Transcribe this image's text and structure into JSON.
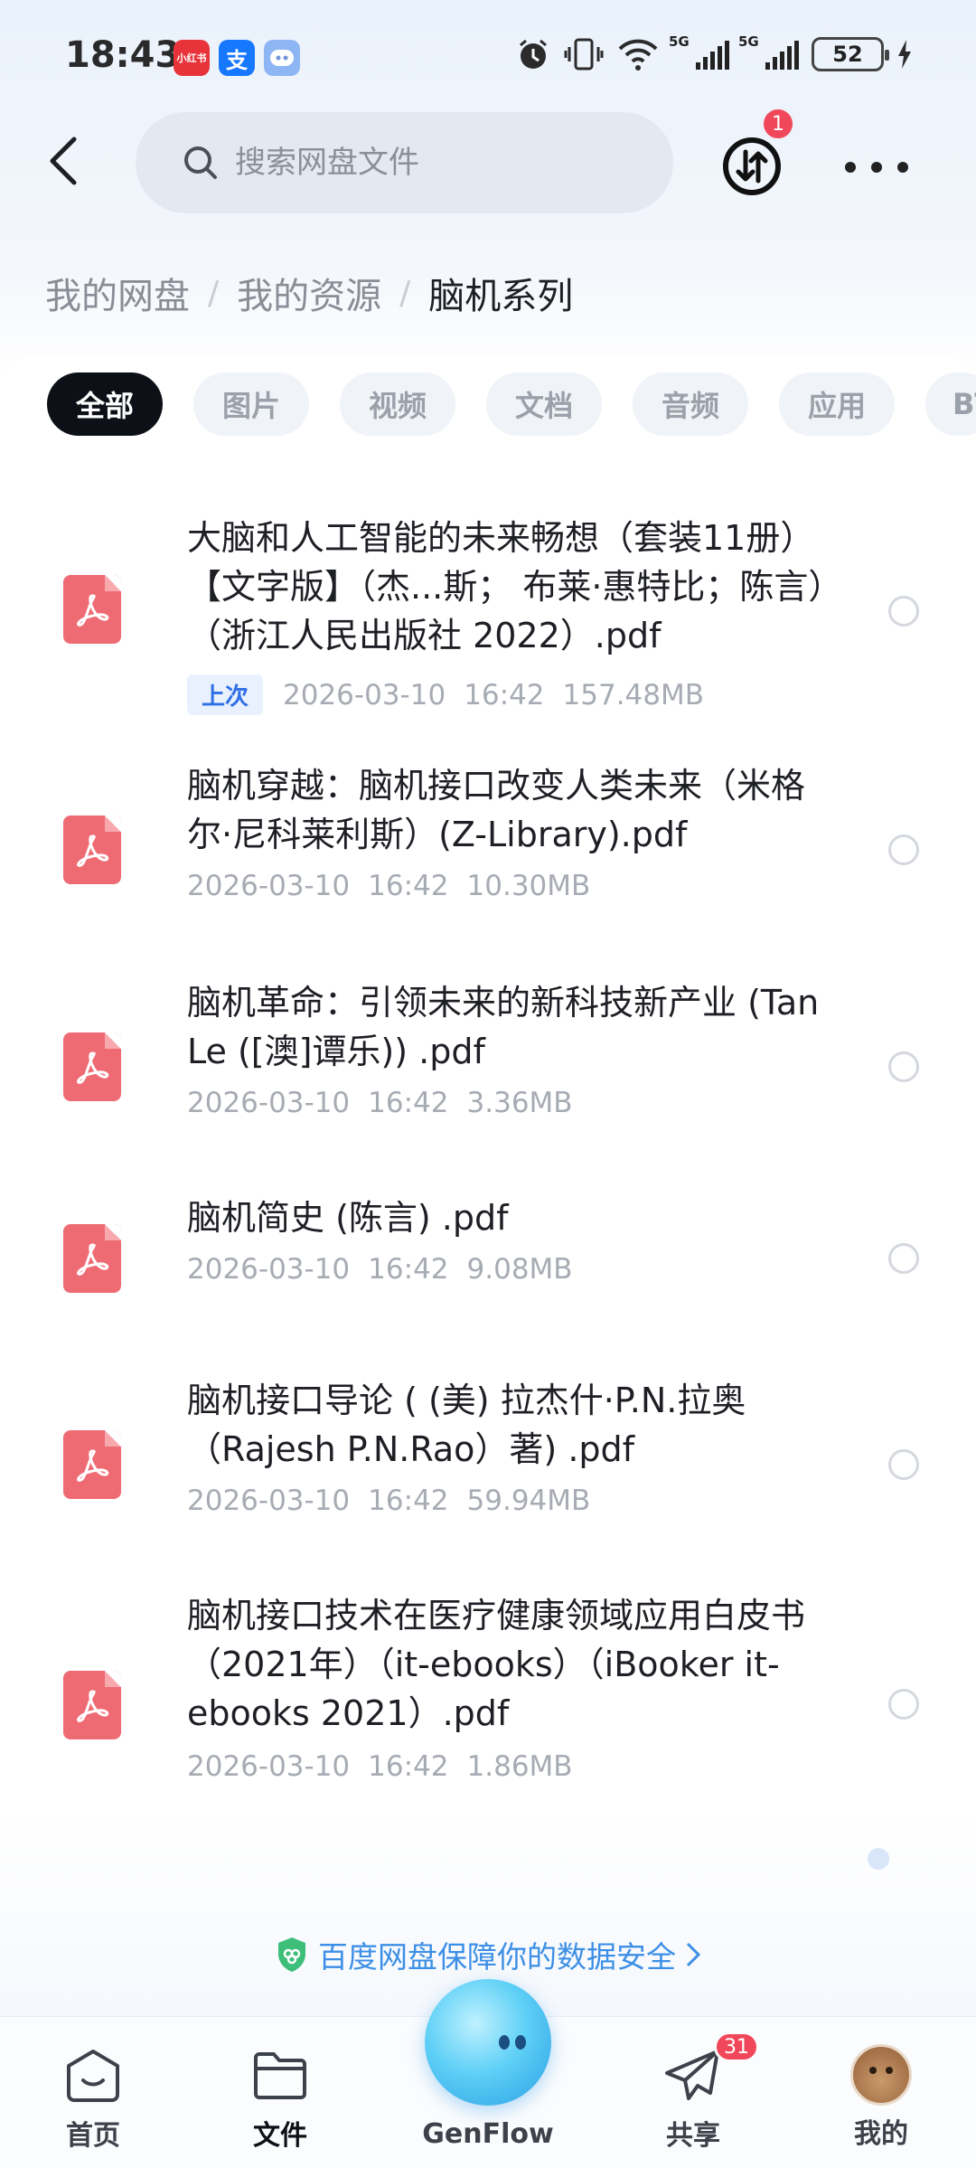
{
  "status_bar": {
    "time": "18:43",
    "app_badges": [
      "小红书",
      "支",
      "bot"
    ],
    "network_labels": [
      "5G",
      "5G"
    ],
    "battery": "52"
  },
  "header": {
    "search_placeholder": "搜索网盘文件",
    "transfer_badge": "1"
  },
  "breadcrumb": [
    "我的网盘",
    "我的资源",
    "脑机系列"
  ],
  "filter_tabs": [
    {
      "label": "全部",
      "active": true
    },
    {
      "label": "图片"
    },
    {
      "label": "视频"
    },
    {
      "label": "文档"
    },
    {
      "label": "音频"
    },
    {
      "label": "应用"
    },
    {
      "label": "BT"
    }
  ],
  "files": [
    {
      "name": "大脑和人工智能的未来畅想（套装11册）【文字版】（杰...斯； 布莱·惠特比；陈言）（浙江人民出版社 2022）.pdf",
      "tag": "上次",
      "date": "2026-03-10",
      "time": "16:42",
      "size": "157.48MB"
    },
    {
      "name": "脑机穿越：脑机接口改变人类未来（米格尔·尼科莱利斯）(Z-Library).pdf",
      "date": "2026-03-10",
      "time": "16:42",
      "size": "10.30MB"
    },
    {
      "name": "脑机革命：引领未来的新科技新产业 (Tan Le ([澳]谭乐)) .pdf",
      "date": "2026-03-10",
      "time": "16:42",
      "size": "3.36MB"
    },
    {
      "name": "脑机简史 (陈言) .pdf",
      "date": "2026-03-10",
      "time": "16:42",
      "size": "9.08MB"
    },
    {
      "name": "脑机接口导论 ( (美) 拉杰什·P.N.拉奥（Rajesh P.N.Rao）著) .pdf",
      "date": "2026-03-10",
      "time": "16:42",
      "size": "59.94MB"
    },
    {
      "name": "脑机接口技术在医疗健康领域应用白皮书（2021年）（it-ebooks）（iBooker it-ebooks 2021）.pdf",
      "date": "2026-03-10",
      "time": "16:42",
      "size": "1.86MB"
    }
  ],
  "security_banner": "百度网盘保障你的数据安全",
  "bottom_nav": {
    "home": "首页",
    "files": "文件",
    "genflow": "GenFlow",
    "share": "共享",
    "share_badge": "31",
    "mine": "我的"
  },
  "colors": {
    "accent": "#0d1117",
    "pdf_icon": "#ef6b74",
    "badge_red": "#f0485a",
    "link_blue": "#3d8fe6"
  }
}
